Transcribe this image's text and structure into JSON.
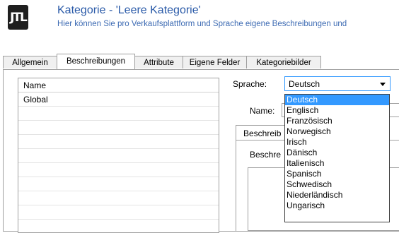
{
  "header": {
    "logo_text": "JTL",
    "title": "Kategorie - 'Leere Kategorie'",
    "subtitle": "Hier können Sie pro Verkaufsplattform und Sprache eigene Beschreibungen und"
  },
  "tabs": [
    {
      "label": "Allgemein"
    },
    {
      "label": "Beschreibungen"
    },
    {
      "label": "Attribute"
    },
    {
      "label": "Eigene Felder"
    },
    {
      "label": "Kategoriebilder"
    }
  ],
  "list": {
    "header": "Name",
    "items": [
      "Global"
    ]
  },
  "form": {
    "language_label": "Sprache:",
    "language_value": "Deutsch",
    "name_label": "Name:",
    "inner_tab_label": "Beschreib",
    "description_label": "Beschre"
  },
  "dropdown": {
    "options": [
      {
        "label": "Deutsch"
      },
      {
        "label": "Englisch"
      },
      {
        "label": "Französisch"
      },
      {
        "label": "Norwegisch"
      },
      {
        "label": "Irisch"
      },
      {
        "label": "Dänisch"
      },
      {
        "label": "Italienisch"
      },
      {
        "label": "Spanisch"
      },
      {
        "label": "Schwedisch"
      },
      {
        "label": "Niederländisch"
      },
      {
        "label": "Ungarisch"
      }
    ]
  },
  "colors": {
    "title": "#2a5aa8",
    "selection": "#3399ff"
  }
}
